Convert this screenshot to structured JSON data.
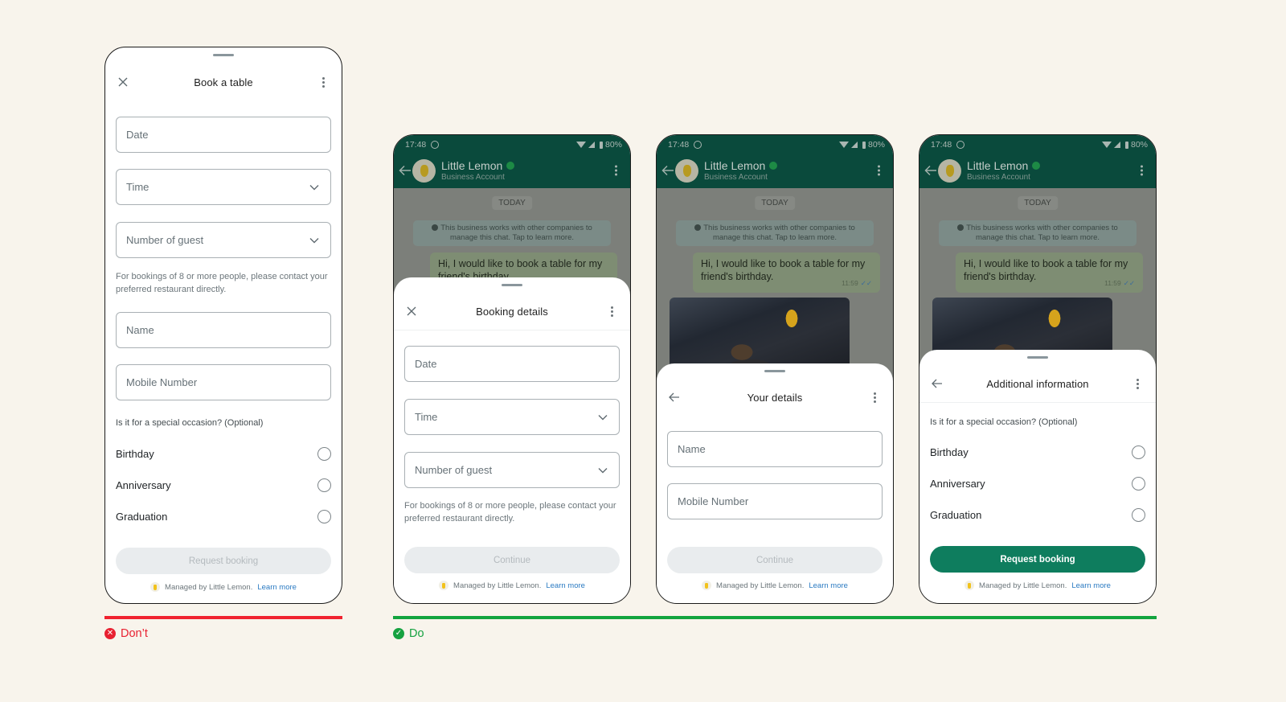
{
  "dont_example": {
    "title": "Book a table",
    "fields": {
      "date": "Date",
      "time": "Time",
      "guests": "Number of guest",
      "name": "Name",
      "mobile": "Mobile Number"
    },
    "helper": "For bookings of 8 or more people, please contact your preferred restaurant directly.",
    "occasion_question": "Is it for a special occasion? (Optional)",
    "occasions": [
      "Birthday",
      "Anniversary",
      "Graduation"
    ],
    "submit_label": "Request booking",
    "managed_text": "Managed by Little Lemon.",
    "learn_more": "Learn more"
  },
  "chat": {
    "time": "17:48",
    "battery": "80%",
    "business_name": "Little Lemon",
    "business_sub": "Business Account",
    "day_label": "TODAY",
    "system_note": "This business works with other companies to manage this chat. Tap to learn more.",
    "message": "Hi, I would like to book a table for my friend's birthday.",
    "message_time": "11:59",
    "message_ticks": "✓✓"
  },
  "do_step1": {
    "title": "Booking details",
    "fields": {
      "date": "Date",
      "time": "Time",
      "guests": "Number of guest"
    },
    "helper": "For bookings of 8 or more people, please contact your preferred restaurant directly.",
    "submit_label": "Continue",
    "managed_text": "Managed by Little Lemon.",
    "learn_more": "Learn more"
  },
  "do_step2": {
    "title": "Your details",
    "fields": {
      "name": "Name",
      "mobile": "Mobile Number"
    },
    "submit_label": "Continue",
    "managed_text": "Managed by Little Lemon.",
    "learn_more": "Learn more"
  },
  "do_step3": {
    "title": "Additional information",
    "occasion_question": "Is it for a special occasion? (Optional)",
    "occasions": [
      "Birthday",
      "Anniversary",
      "Graduation"
    ],
    "submit_label": "Request booking",
    "managed_text": "Managed by Little Lemon.",
    "learn_more": "Learn more"
  },
  "verdicts": {
    "dont": "Don’t",
    "do": "Do"
  },
  "colors": {
    "dont": "#e82131",
    "do": "#16a241",
    "primary_button": "#0e7d5e",
    "chat_header": "#0a4a3c",
    "link": "#2a7ac2"
  }
}
